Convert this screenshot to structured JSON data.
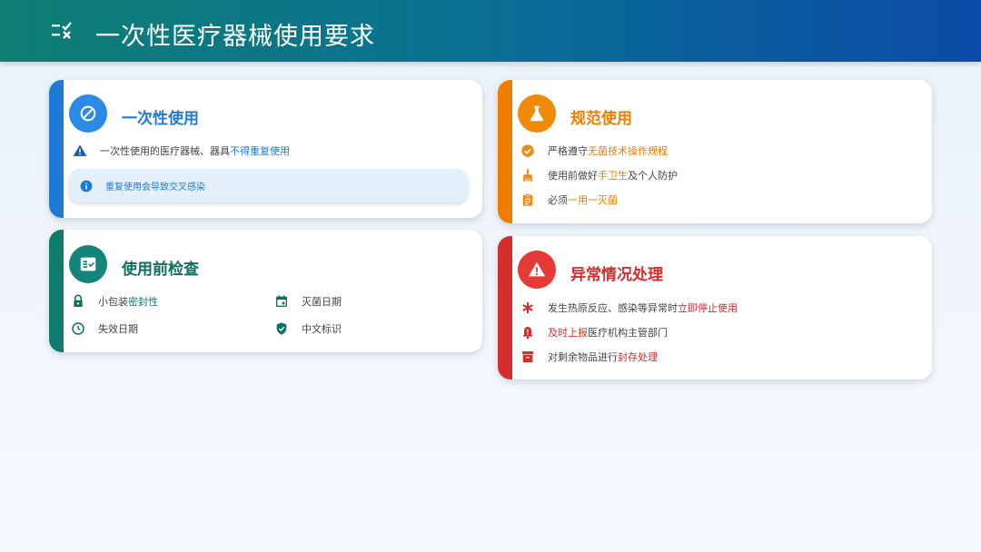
{
  "header": {
    "title": "一次性医疗器械使用要求",
    "icon": "checklist-icon"
  },
  "cards": {
    "single_use": {
      "title": "一次性使用",
      "icon": "block-icon",
      "accent": "#1f7ad6",
      "row1": {
        "icon": "warning-icon",
        "text": "一次性使用的医疗器械、器具",
        "highlight": "不得重复使用"
      },
      "info": {
        "icon": "info-icon",
        "text": "重复使用会导致交叉感染"
      }
    },
    "pre_check": {
      "title": "使用前检查",
      "icon": "fact-check-icon",
      "accent": "#0e7b6b",
      "items": [
        {
          "icon": "lock-icon",
          "text": "小包装",
          "highlight": "密封性"
        },
        {
          "icon": "calendar-icon",
          "text": "灭菌日期",
          "highlight": ""
        },
        {
          "icon": "clock-icon",
          "text": "失效日期",
          "highlight": ""
        },
        {
          "icon": "shield-check-icon",
          "text": "中文标识",
          "highlight": ""
        }
      ]
    },
    "standard_use": {
      "title": "规范使用",
      "icon": "flask-icon",
      "accent": "#ef7d00",
      "items": [
        {
          "icon": "check-circle-icon",
          "text": "严格遵守",
          "highlight": "无菌技术操作规程",
          "after": ""
        },
        {
          "icon": "hand-wash-icon",
          "text": "使用前做好",
          "highlight": "手卫生",
          "after": "及个人防护"
        },
        {
          "icon": "clipboard-icon",
          "text": "必须",
          "highlight": "一用一灭菌",
          "after": ""
        }
      ]
    },
    "abnormal": {
      "title": "异常情况处理",
      "icon": "alert-icon",
      "accent": "#d42e2e",
      "items": [
        {
          "icon": "asterisk-icon",
          "text": "发生热原反应、感染等异常时",
          "highlight": "立即停止使用",
          "after": ""
        },
        {
          "icon": "notification-alert-icon",
          "text": "",
          "highlight": "及时上报",
          "after": "医疗机构主管部门"
        },
        {
          "icon": "archive-icon",
          "text": "对剩余物品进行",
          "highlight": "封存处理",
          "after": ""
        }
      ]
    }
  }
}
